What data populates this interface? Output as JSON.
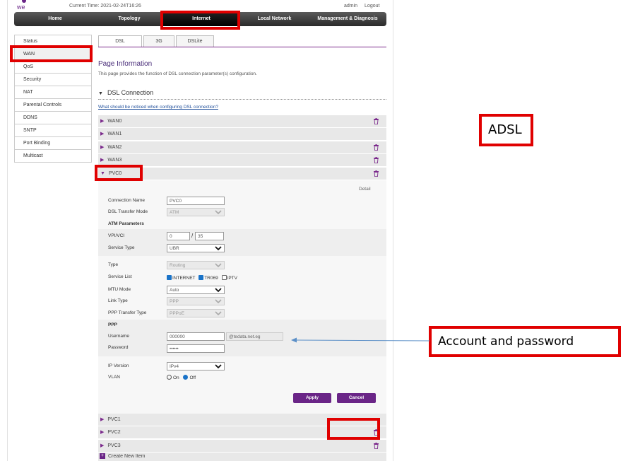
{
  "header": {
    "current_time": "Current Time: 2021-02-24T16:26",
    "user": "admin",
    "logout": "Logout"
  },
  "top_nav": [
    "Home",
    "Topology",
    "Internet",
    "Local Network",
    "Management & Diagnosis"
  ],
  "top_nav_active": "Internet",
  "sidebar": [
    "Status",
    "WAN",
    "QoS",
    "Security",
    "NAT",
    "Parental Controls",
    "DDNS",
    "SNTP",
    "Port Binding",
    "Multicast"
  ],
  "tabs": [
    "DSL",
    "3G",
    "DSLite"
  ],
  "page": {
    "title": "Page Information",
    "description": "This page provides the function of DSL connection parameter(s) configuration.",
    "section": "DSL Connection",
    "notice_link": "What should be noticed when configuring DSL connection?"
  },
  "wan_rows": [
    "WAN0",
    "WAN1",
    "WAN2",
    "WAN3"
  ],
  "pvc_open": "PVC0",
  "detail_link": "Detail",
  "form": {
    "connection_name_label": "Connection Name",
    "connection_name_value": "PVC0",
    "transfer_mode_label": "DSL Transfer Mode",
    "transfer_mode_value": "ATM",
    "atm_params_label": "ATM Parameters",
    "vpi_vci_label": "VPI/VCI",
    "vpi_value": "0",
    "vci_separator": "/",
    "vci_value": "35",
    "service_type_label": "Service Type",
    "service_type_value": "UBR",
    "type_label": "Type",
    "type_value": "Routing",
    "service_list_label": "Service List",
    "service_internet": "INTERNET",
    "service_tr069": "TR069",
    "service_iptv": "IPTV",
    "mtu_mode_label": "MTU Mode",
    "mtu_mode_value": "Auto",
    "link_type_label": "Link Type",
    "link_type_value": "PPP",
    "ppp_transfer_label": "PPP Transfer Type",
    "ppp_transfer_value": "PPPoE",
    "ppp_label": "PPP",
    "username_label": "Username",
    "username_value": "000000",
    "username_suffix": "@tedata.net.eg",
    "password_label": "Password",
    "password_value": "••••••",
    "ip_version_label": "IP Version",
    "ip_version_value": "IPv4",
    "vlan_label": "VLAN",
    "vlan_on": "On",
    "vlan_off": "Off"
  },
  "buttons": {
    "apply": "Apply",
    "cancel": "Cancel"
  },
  "pvc_rows": [
    "PVC1",
    "PVC2",
    "PVC3"
  ],
  "create_new": "Create New Item",
  "callouts": {
    "adsl": "ADSL",
    "account": "Account and password"
  },
  "colors": {
    "highlight": "#e00000",
    "accent": "#6a2587"
  }
}
